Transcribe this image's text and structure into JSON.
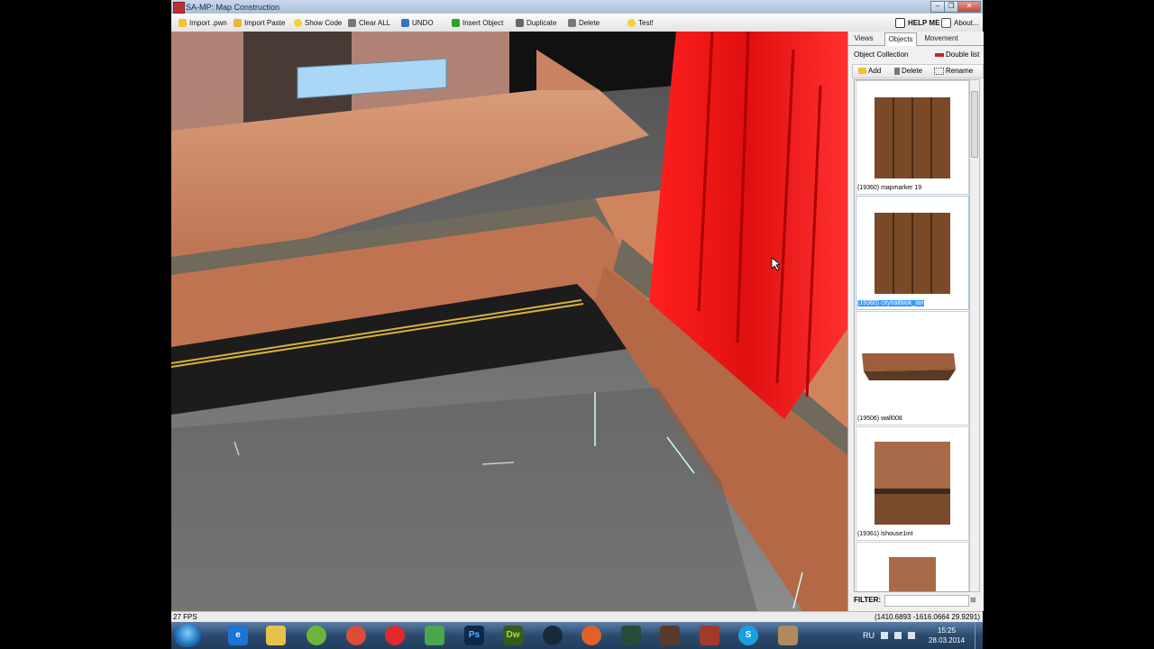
{
  "window": {
    "title": "SA-MP: Map Construction",
    "controls": [
      "–",
      "❐",
      "✕"
    ]
  },
  "toolbar": {
    "buttons": [
      "Import .pwn",
      "Import Paste",
      "Show Code",
      "Clear ALL",
      "UNDO",
      "Insert Object",
      "Duplicate",
      "Delete",
      "Test!"
    ],
    "help": "HELP ME",
    "about": "About..."
  },
  "panel": {
    "tabs": [
      "Views",
      "Objects",
      "Movement"
    ],
    "collection_label": "Object Collection",
    "double_list": "Double list",
    "actions": [
      "Add",
      "Delete",
      "Rename"
    ],
    "items": [
      {
        "label": "(19360) mapmarker 19",
        "selected": false
      },
      {
        "label": "(19360) cityhallblok_lan",
        "selected": true
      },
      {
        "label": "(19506) wall008",
        "selected": false
      },
      {
        "label": "(19361) lshouse1int",
        "selected": false
      },
      {
        "label": "",
        "selected": false
      }
    ],
    "filter_label": "FILTER:",
    "filter_value": "",
    "filter_clear": "⊠"
  },
  "status": {
    "fps": "27 FPS",
    "coords": "(1410.6893 -1616.0664 29.9291)"
  },
  "taskbar": {
    "apps": [
      "e",
      "",
      "",
      "",
      "",
      "",
      "Ps",
      "Dw",
      "",
      "",
      "",
      "",
      "",
      "S",
      ""
    ],
    "lang": "RU",
    "time": "15:25",
    "date": "28.03.2014"
  }
}
